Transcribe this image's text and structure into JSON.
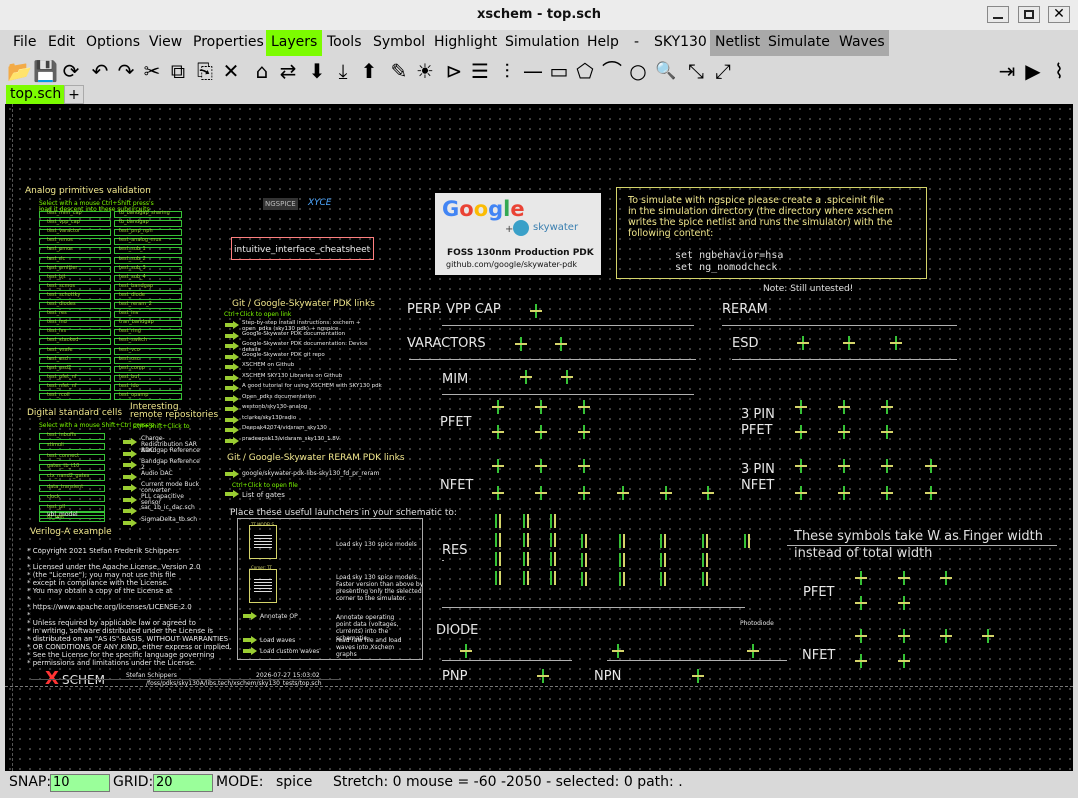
{
  "window": {
    "title": "xschem - top.sch"
  },
  "menu": [
    "File",
    "Edit",
    "Options",
    "View",
    "Properties",
    "Layers",
    "Tools",
    "Symbol",
    "Highlight",
    "Simulation",
    "Help",
    "-",
    "SKY130",
    "Netlist",
    "Simulate",
    "Waves"
  ],
  "tabs": {
    "active": "top.sch",
    "add": "+"
  },
  "toolbar_icons": [
    "open-icon",
    "save-icon",
    "reload-icon",
    "undo-icon",
    "redo-icon",
    "cut-icon",
    "copy-icon",
    "paste-icon",
    "delete-icon",
    "place-symbol-icon",
    "swap-icon",
    "push-icon",
    "pop-in-icon",
    "pop-out-icon",
    "pencil-icon",
    "bulb-icon",
    "gate-icon",
    "list-icon",
    "pin-icon",
    "line-icon",
    "rect-icon",
    "polygon-icon",
    "arc-icon",
    "circle-icon",
    "zoom-icon",
    "zoom-in-icon",
    "zoom-out-icon",
    "netlist-icon",
    "simulate-icon",
    "waves-icon"
  ],
  "toolbar_glyphs": [
    "📂",
    "💾",
    "⟳",
    "↶",
    "↷",
    "✂",
    "⧉",
    "⎘",
    "✕",
    "⌂",
    "⇄",
    "⬇",
    "⤓",
    "⬆",
    "✎",
    "☀",
    "⊳",
    "☰",
    "⫶",
    "—",
    "▭",
    "⬠",
    "⌒",
    "○",
    "🔍",
    "⤡",
    "⤢",
    "⇥",
    "▶",
    "⌇"
  ],
  "canvas": {
    "analog_title": "Analog primitives validation",
    "analog_sub1": "Select with a mouse Ctrl+Shift press's",
    "analog_sub2": "load it  descent into these subcircuits",
    "analog_left": [
      "test_mim_cap",
      "test_vpp_cap",
      "test_varactor",
      "test_nmos",
      "test_pmos",
      "test_rlc",
      "test_emitter",
      "test_bjt",
      "test_scmos",
      "test_schottky",
      "test_diodes",
      "test_res",
      "test_ind",
      "test_lvs",
      "test_stacked",
      "test_vsafe",
      "test_esd",
      "test_esd2",
      "test_pfet_nf",
      "test_nfet_nf",
      "test_rcoil"
    ],
    "analog_right": [
      "tb_bandgap_sharing",
      "tb_bandgap",
      "test_pnp_npn",
      "test_analog_mux",
      "test_sub_1",
      "test_sub_2",
      "test_sub_3",
      "test_sub_4",
      "test_bandgap",
      "test_diode",
      "test_reram_2",
      "test_inv",
      "tran_bandgap",
      "test_ring",
      "test_switch",
      "test_vco",
      "test_osc",
      "test_comp",
      "test_buf",
      "test_ldo",
      "test_opamp"
    ],
    "digital_title": "Digital standard cells",
    "digital_sub": "Select with a mouse Shift+Ctrl press's",
    "digital_items": [
      "test_inbuffs",
      "stimuli",
      "test_connect",
      "gates_tb_t10",
      "ctx_nand2_gates",
      "data_transient",
      "clock",
      "test_pll",
      "tb_test"
    ],
    "interesting_title": "Interesting",
    "remote_title": "remote repositories",
    "remote_sub": "Ctrl+Shift+Click to",
    "remote_items": [
      "Charge-Redistribution SAR ADC",
      "Bandgap Reference",
      "Bandgap Reference 2",
      "Audio DAC",
      "Current mode Buck converter",
      "PLL capacitive sensor",
      "sar_1b_ic_dac.sch",
      "SigmaDelta_tb.sch"
    ],
    "verilog_title": "Verilog-A example",
    "verilog_box": "vbl_model",
    "license": [
      "* Copyright 2021 Stefan Frederik Schippers",
      "*",
      "* Licensed under the Apache License, Version 2.0",
      "* (the \"License\"); you may not use this file",
      "* except in compliance with the License.",
      "* You may obtain a copy of the License at",
      "*",
      "*     https://www.apache.org/licenses/LICENSE-2.0",
      "*",
      "* Unless required by applicable law or agreed to",
      "* in writing, software distributed under the License is",
      "* distributed on an \"AS IS\" BASIS, WITHOUT WARRANTIES",
      "* OR CONDITIONS OF ANY KIND, either express or implied.",
      "* See the License for the specific language governing",
      "* permissions and limitations under the License."
    ],
    "logo_text": "SCHEM",
    "logo_x": "X",
    "author": "Stefan Schippers",
    "date": "2026-07-27  15:03:02",
    "path": "/foss/pdks/sky130A/libs.tech/xschem/sky130_tests/top.sch",
    "ngspice_logo": "NGSPICE",
    "xyce_logo": "XYCE",
    "cheatsheet": "intuitive_interface_cheatsheet",
    "git_title": "Git / Google-Skywater PDK links",
    "git_sub": "Ctrl+Click to open link",
    "git_links": [
      "Step-by-step install instructions: xschem + open_pdks (sky130 pdk) + ngspice",
      "Google-Skywater PDK documentation",
      "Google-Skywater PDK documentation: Device details",
      "Google-Skywater PDK git repo",
      "XSCHEM on Github",
      "XSCHEM SKY130 Libraries on Github",
      "A good tutorial for using XSCHEM with SKY130 pdk",
      "Open_pdks documentation",
      "westonb/sky130-analog",
      "tclarke/sky130radio",
      "Deepak42074/vidsram_sky130",
      "pradeepsk13/vidsram_sky130_1.8V"
    ],
    "reram_title": "Git / Google-Skywater RERAM PDK links",
    "reram_links": [
      "google/skywater-pdk-libs-sky130_fd_pr_reram"
    ],
    "gates_sub": "Ctrl+Click to open file",
    "gates": "List of gates",
    "launchers_title": "Place these useful launchers in your schematic to:",
    "launchers": [
      "Load sky 130 spice models",
      "Load sky 130 spice models. Faster version than above by presenting only the selected corner to the simulator.",
      "Annotate operating point data (voltages, currents) into the schematic.",
      "read raw file and load waves into Xschem graphs"
    ],
    "launcher_tags": [
      "TT MODELS",
      "Corner: TT",
      "Annotate OP",
      "Load waves",
      "Load custom waves"
    ],
    "google_text": "Google",
    "skywater_text": "skywater",
    "pdk_caption1": "FOSS 130nm Production PDK",
    "pdk_caption2": "github.com/google/skywater-pdk",
    "sim_note": [
      "To simulate with ngspice please create a .spiceinit file",
      "in the simulation directory (the directory where xschem",
      "writes the spice netlist and runs the simulator) with the",
      "following content:"
    ],
    "sim_code": [
      "set ngbehavior=hsa",
      "set ng_nomodcheck"
    ],
    "untested": "Note: Still untested!",
    "labels": {
      "perp": "PERP. VPP CAP",
      "varactors": "VARACTORS",
      "mim": "MIM",
      "pfet": "PFET",
      "nfet": "NFET",
      "res": "RES",
      "diode": "DIODE",
      "pnp": "PNP",
      "npn": "NPN",
      "reram": "RERAM",
      "esd": "ESD",
      "pfet3a": "3 PIN",
      "pfet3b": "PFET",
      "nfet3a": "3 PIN",
      "nfet3b": "NFET",
      "pfet_f": "PFET",
      "nfet_f": "NFET",
      "photodiode": "Photodiode"
    },
    "finger_note": [
      "These symbols take W as Finger width",
      "instead of total width"
    ]
  },
  "status": {
    "snap_label": "SNAP:",
    "snap": "10",
    "grid_label": "GRID:",
    "grid": "20",
    "mode_label": "MODE:",
    "mode": "spice",
    "rest": "Stretch: 0  mouse = -60 -2050 - selected: 0 path: ."
  },
  "colors": {
    "layers_active": "#7cfc00",
    "sim_menu": "#a9a9a9",
    "canvas_bg": "#000000",
    "wire": "#36c236",
    "text_yellow": "#f0e68c"
  }
}
